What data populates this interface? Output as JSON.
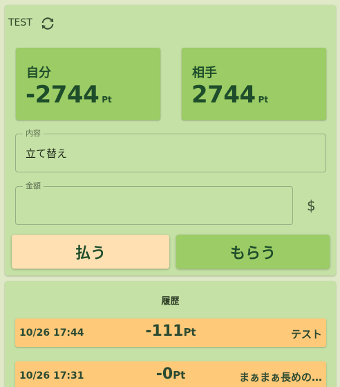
{
  "header": {
    "title": "TEST",
    "refresh_icon": "refresh-icon"
  },
  "balances": {
    "me": {
      "label": "自分",
      "value": "-2744",
      "unit": "Pt"
    },
    "partner": {
      "label": "相手",
      "value": "2744",
      "unit": "Pt"
    }
  },
  "form": {
    "content": {
      "label": "内容",
      "value": "立て替え"
    },
    "amount": {
      "label": "金額",
      "value": "",
      "icon": "dollar-icon",
      "icon_glyph": "$"
    }
  },
  "actions": {
    "pay_label": "払う",
    "receive_label": "もらう"
  },
  "history": {
    "title": "履歴",
    "items": [
      {
        "date": "10/26 17:44",
        "amount": "-111",
        "unit": "Pt",
        "memo": "テスト"
      },
      {
        "date": "10/26 17:31",
        "amount": "-0",
        "unit": "Pt",
        "memo": "まぁまぁ長めの…"
      }
    ]
  },
  "colors": {
    "panel": "#c5e1a5",
    "card": "#9ccc65",
    "pay_button": "#ffe0b2",
    "history_row": "#ffc97a",
    "text_dark_green": "#1e4d2b"
  }
}
